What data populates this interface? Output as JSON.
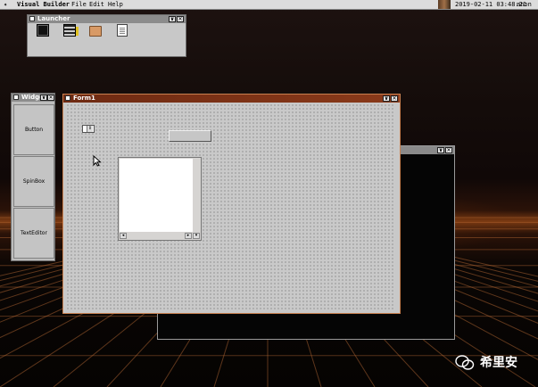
{
  "menubar": {
    "logo": "✦",
    "app_name": "Visual Builder",
    "menus": [
      "File",
      "Edit",
      "Help"
    ],
    "clock": "2019-02-11 03:48:21",
    "user": "anon"
  },
  "launcher": {
    "title": "Launcher",
    "icons": [
      "terminal-icon",
      "film-icon",
      "folder-icon",
      "document-icon"
    ]
  },
  "widgets_palette": {
    "title": "Widge",
    "items": [
      "Button",
      "SpinBox",
      "TextEditor"
    ]
  },
  "form": {
    "title": "Form1"
  },
  "title_buttons": {
    "minimize": "∨",
    "close": "✕"
  },
  "watermark": {
    "text": "希里安"
  },
  "colors": {
    "active_titlebar": "#7a2e14",
    "inactive_titlebar": "#8a8a8a",
    "menubar": "#dcdcdc",
    "window_bg": "#c8c8c8"
  }
}
